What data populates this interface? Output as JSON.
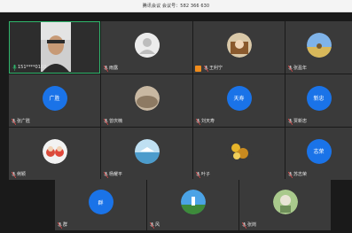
{
  "window": {
    "title": "腾讯会议 会议号：582 366 630"
  },
  "participants": [
    {
      "name": "151****0168",
      "avatar_text": ""
    },
    {
      "name": "雨露",
      "avatar_text": ""
    },
    {
      "name": "王利宁",
      "avatar_text": ""
    },
    {
      "name": "张盈年",
      "avatar_text": ""
    },
    {
      "name": "张广胜",
      "avatar_text": "广胜"
    },
    {
      "name": "曾庆楠",
      "avatar_text": ""
    },
    {
      "name": "刘天寿",
      "avatar_text": "天寿"
    },
    {
      "name": "贾新忠",
      "avatar_text": "新忠"
    },
    {
      "name": "俐颖",
      "avatar_text": ""
    },
    {
      "name": "杨耀平",
      "avatar_text": ""
    },
    {
      "name": "叶子",
      "avatar_text": ""
    },
    {
      "name": "苏志荣",
      "avatar_text": "志荣"
    },
    {
      "name": "群",
      "avatar_text": "群"
    },
    {
      "name": "风",
      "avatar_text": ""
    },
    {
      "name": "张岗",
      "avatar_text": ""
    }
  ],
  "colors": {
    "active_border": "#2fb56b",
    "avatar_blue": "#1a73e8",
    "host_badge": "#f08c1c"
  }
}
